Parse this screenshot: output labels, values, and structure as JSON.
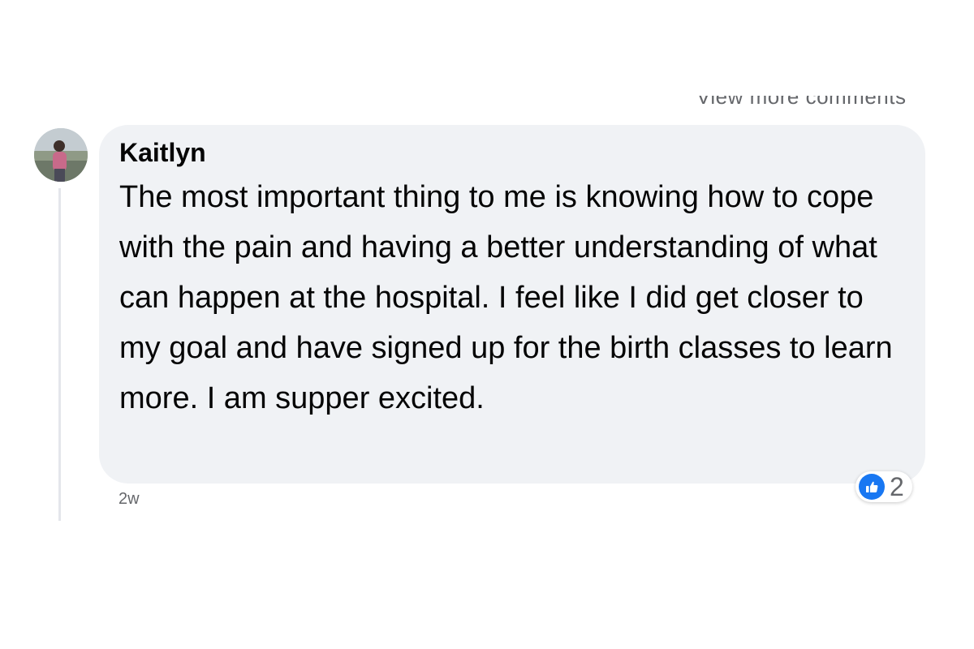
{
  "header": {
    "cutoff_text": "View more comments"
  },
  "comment": {
    "author": "Kaitlyn",
    "text": "The most important thing to me is knowing how to cope with the pain and having a better understanding of what can happen at the hospital. I feel like I did get closer to my goal and have signed up for the birth classes to learn more. I am supper excited.",
    "timestamp": "2w",
    "reactions": {
      "icon": "like-icon",
      "count": "2"
    }
  },
  "colors": {
    "bubble": "#f0f2f5",
    "like_blue": "#1877f2",
    "secondary_text": "#65676b"
  }
}
